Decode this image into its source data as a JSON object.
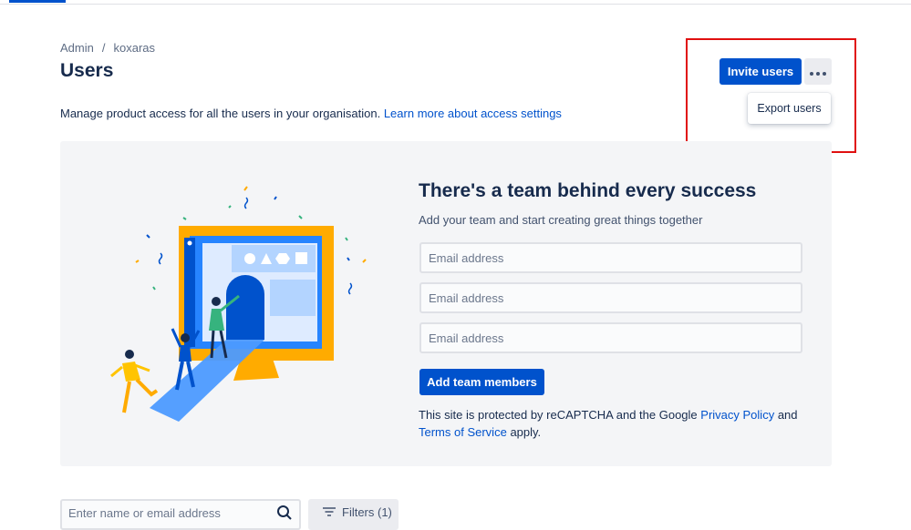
{
  "breadcrumb": {
    "root": "Admin",
    "separator": "/",
    "current": "koxaras"
  },
  "page": {
    "title": "Users",
    "description": "Manage product access for all the users in your organisation.",
    "learn_more_link": "Learn more about access settings"
  },
  "actions": {
    "invite_label": "Invite users",
    "more_icon": "more-horizontal-icon",
    "menu_items": [
      "Export users"
    ]
  },
  "onboarding": {
    "heading": "There's a team behind every success",
    "subheading": "Add your team and start creating great things together",
    "email_placeholder": "Email address",
    "add_button": "Add team members",
    "legal_prefix": "This site is protected by reCAPTCHA and the Google",
    "privacy_link": "Privacy Policy",
    "legal_and": "and",
    "terms_link": "Terms of Service",
    "legal_suffix": "apply."
  },
  "filter_bar": {
    "search_placeholder": "Enter name or email address",
    "search_icon": "search-icon",
    "filters_label": "Filters (1)",
    "filters_icon": "filter-lines-icon"
  },
  "colors": {
    "primary": "#0052cc",
    "highlight_box": "#e01010",
    "panel_bg": "#f4f5f7",
    "text": "#172b4d"
  }
}
